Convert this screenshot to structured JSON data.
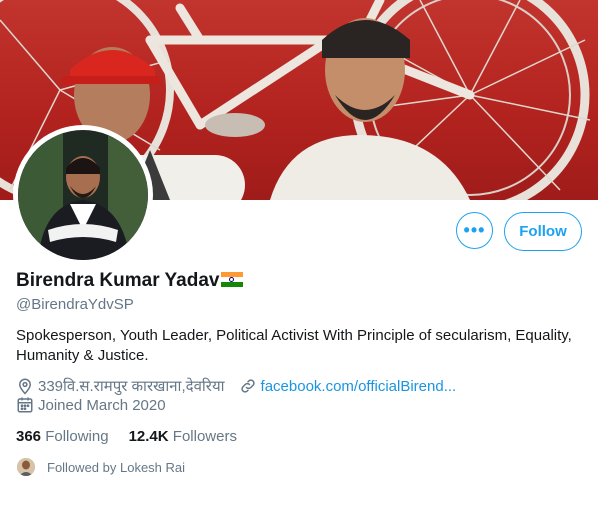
{
  "profile": {
    "name": "Birendra Kumar Yadav",
    "handle": "@BirendraYdvSP",
    "bio": "Spokesperson, Youth Leader, Political Activist With Principle of secularism, Equality, Humanity & Justice.",
    "location": "339वि.स.रामपुर कारखाना,देवरिया",
    "website": "facebook.com/officialBirend...",
    "joined": "Joined March 2020"
  },
  "stats": {
    "following_count": "366",
    "following_label": "Following",
    "followers_count": "12.4K",
    "followers_label": "Followers"
  },
  "followed_by": "Followed by Lokesh Rai",
  "buttons": {
    "more": "•••",
    "follow": "Follow"
  },
  "colors": {
    "accent": "#1da1f2",
    "secondary_text": "#657786",
    "banner_red": "#b3231f"
  },
  "icons": [
    "location-icon",
    "link-icon",
    "calendar-icon",
    "more-icon",
    "flag-india-icon"
  ]
}
